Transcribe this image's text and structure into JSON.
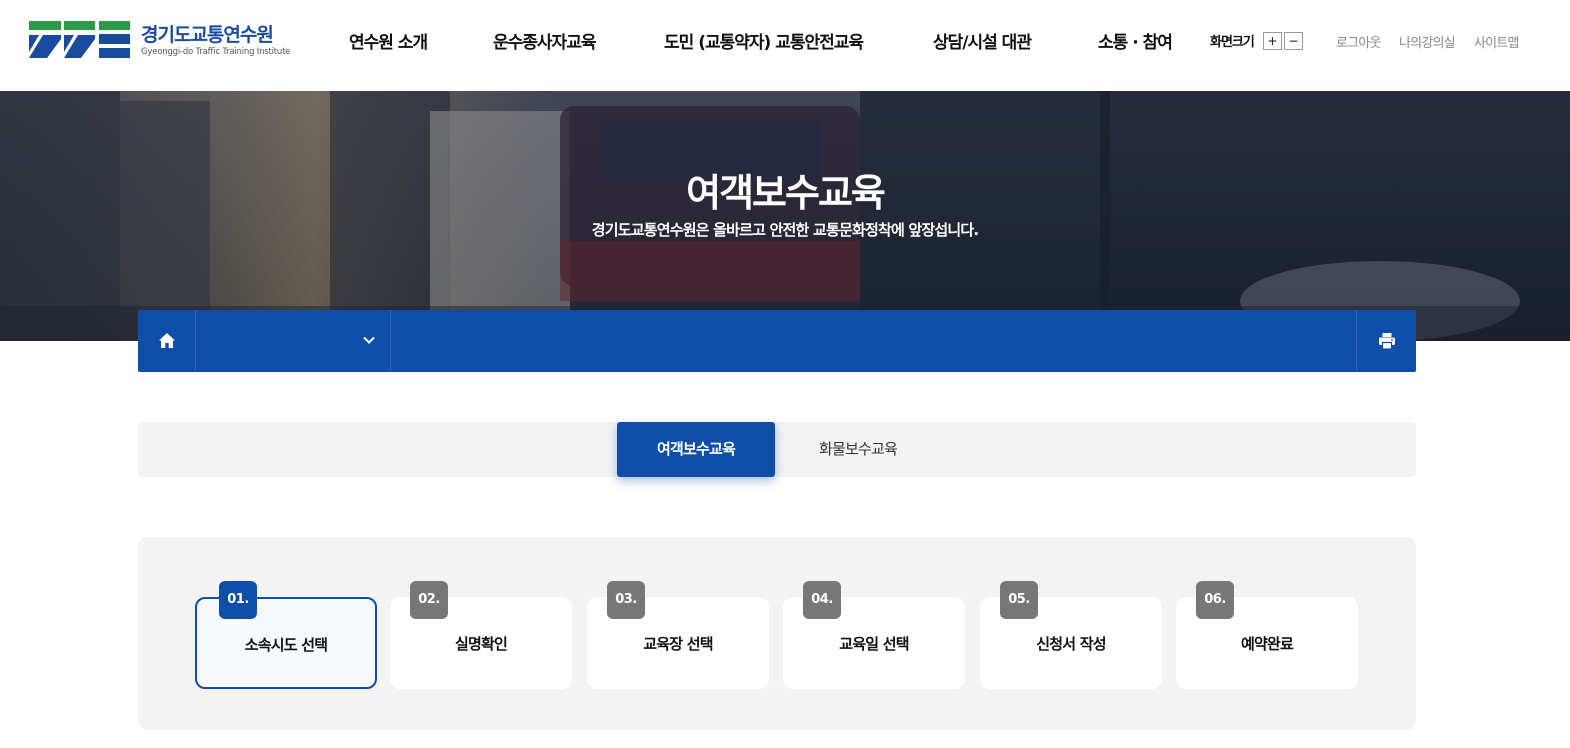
{
  "header": {
    "logo": {
      "name_ko": "경기도교통연수원",
      "name_en": "Gyeonggi-do Traffic Training Institute"
    },
    "gnb": [
      "연수원 소개",
      "운수종사자교육",
      "도민 (교통약자) 교통안전교육",
      "상담/시설 대관",
      "소통 · 참여"
    ],
    "zoom": {
      "label": "화면크기",
      "plus": "+",
      "minus": "−"
    },
    "util": [
      "로그아웃",
      "나의강의실",
      "사이트맵"
    ]
  },
  "hero": {
    "title": "여객보수교육",
    "subtitle": "경기도교통연수원은 올바르고 안전한 교통문화정착에 앞장섭니다."
  },
  "location_bar": {
    "home_icon": "home-icon",
    "dropdown_icon": "chevron-down-icon",
    "print_icon": "print-icon"
  },
  "tabs": [
    {
      "label": "여객보수교육",
      "active": true
    },
    {
      "label": "화물보수교육",
      "active": false
    }
  ],
  "steps": [
    {
      "num": "01.",
      "label": "소속시도 선택",
      "active": true
    },
    {
      "num": "02.",
      "label": "실명확인",
      "active": false
    },
    {
      "num": "03.",
      "label": "교육장 선택",
      "active": false
    },
    {
      "num": "04.",
      "label": "교육일 선택",
      "active": false
    },
    {
      "num": "05.",
      "label": "신청서 작성",
      "active": false
    },
    {
      "num": "06.",
      "label": "예약완료",
      "active": false
    }
  ],
  "colors": {
    "primary": "#0e4ea8",
    "logo_green": "#2e9a48",
    "step_inactive": "#777777",
    "panel_bg": "#f3f3f3"
  }
}
